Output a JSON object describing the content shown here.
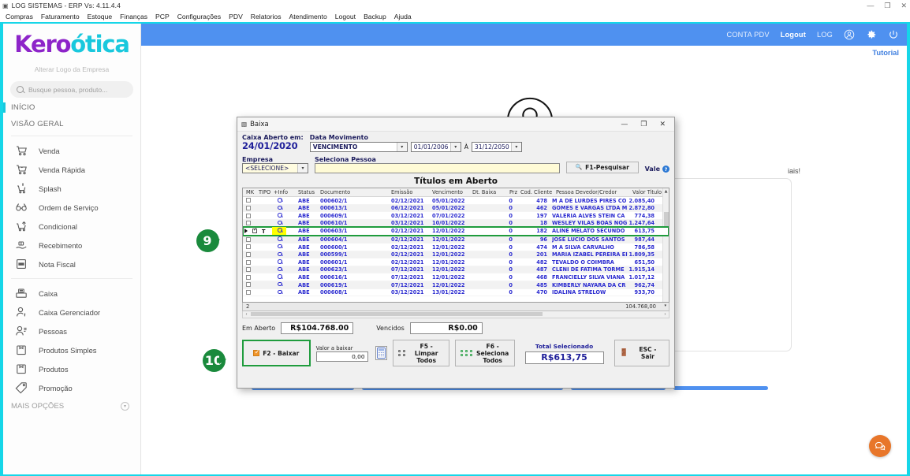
{
  "window": {
    "title": "LOG SISTEMAS - ERP Vs: 4.11.4.4",
    "icon": "app-icon",
    "minimize": "—",
    "maximize": "❐",
    "close": "✕"
  },
  "menubar": [
    {
      "label": "Compras"
    },
    {
      "label": "Faturamento"
    },
    {
      "label": "Estoque"
    },
    {
      "label": "Finanças"
    },
    {
      "label": "PCP"
    },
    {
      "label": "Configurações"
    },
    {
      "label": "PDV"
    },
    {
      "label": "Relatorios"
    },
    {
      "label": "Atendimento"
    },
    {
      "label": "Logout"
    },
    {
      "label": "Backup"
    },
    {
      "label": "Ajuda"
    }
  ],
  "sidebar": {
    "logo_part1": "Kero",
    "logo_part2": "ótica",
    "logo_sub": "Alterar Logo da Empresa",
    "search_placeholder": "Busque pessoa, produto...",
    "section_inicio": "INÍCIO",
    "section_visao": "VISÃO GERAL",
    "items": [
      {
        "label": "Venda",
        "icon": "cart-icon"
      },
      {
        "label": "Venda Rápida",
        "icon": "cart-fast-icon"
      },
      {
        "label": "Splash",
        "icon": "cart-dollar-icon"
      },
      {
        "label": "Ordem de Serviço",
        "icon": "glasses-icon"
      },
      {
        "label": "Condicional",
        "icon": "cart-arrow-icon"
      },
      {
        "label": "Recebimento",
        "icon": "hand-money-icon"
      },
      {
        "label": "Nota Fiscal",
        "icon": "nfe-icon"
      }
    ],
    "items2": [
      {
        "label": "Caixa",
        "icon": "cash-register-icon"
      },
      {
        "label": "Caixa Gerenciador",
        "icon": "user-dollar-icon"
      },
      {
        "label": "Pessoas",
        "icon": "user-list-icon"
      },
      {
        "label": "Produtos Simples",
        "icon": "box-simple-icon"
      },
      {
        "label": "Produtos",
        "icon": "box-icon"
      },
      {
        "label": "Promoção",
        "icon": "tag-icon"
      }
    ],
    "more_label": "MAIS OPÇÕES",
    "more_icon": "chevron-down-circle-icon"
  },
  "header": {
    "conta_pdv": "CONTA PDV",
    "logout": "Logout",
    "log": "LOG",
    "user_icon": "user-circle-icon",
    "gear_icon": "gear-icon",
    "power_icon": "power-icon",
    "tutorial": "Tutorial",
    "accent": "#4f91f0"
  },
  "background": {
    "avatar_icon": "user-avatar-icon",
    "hint_text": "iais!",
    "chat_icon": "chat-bubble-icon",
    "chat_color": "#e8762a"
  },
  "dialog": {
    "title": "Baixa",
    "title_icon": "window-icon",
    "minimize": "—",
    "maximize": "❐",
    "close": "✕",
    "caixa_aberto_label": "Caixa Aberto em:",
    "caixa_aberto_value": "24/01/2020",
    "data_movimento_label": "Data Movimento",
    "data_movimento_value": "VENCIMENTO",
    "date_from": "01/01/2006",
    "date_sep": "À",
    "date_to": "31/12/2050",
    "empresa_label": "Empresa",
    "empresa_value": "<SELECIONE>",
    "pessoa_label": "Seleciona Pessoa",
    "pessoa_value": "",
    "pesquisar_button": "F1-Pesquisar",
    "pesquisar_icon": "search-icon",
    "vale_label": "Vale",
    "vale_icon": "help-icon",
    "grid_title": "Títulos em Aberto",
    "columns": [
      "MK",
      "TIPO",
      "+Info",
      "Status",
      "Documento",
      "Emissão",
      "Vencimento",
      "Dt. Baixa",
      "Prz",
      "Cod. Cliente",
      "Pessoa Devedor/Credor",
      "Valor Titulo"
    ],
    "rows": [
      {
        "tipo": "",
        "status": "ABE",
        "documento": "000602/1",
        "emissao": "02/12/2021",
        "vencimento": "05/01/2022",
        "dt_baixa": "",
        "prz": "0",
        "cod": "478",
        "pessoa": "M A DE LURDES PIRES CO",
        "valor": "2.085,40",
        "selected": false
      },
      {
        "tipo": "",
        "status": "ABE",
        "documento": "000613/1",
        "emissao": "06/12/2021",
        "vencimento": "05/01/2022",
        "dt_baixa": "",
        "prz": "0",
        "cod": "462",
        "pessoa": "GOMES E VARGAS LTDA M",
        "valor": "2.872,80",
        "selected": false
      },
      {
        "tipo": "",
        "status": "ABE",
        "documento": "000609/1",
        "emissao": "03/12/2021",
        "vencimento": "07/01/2022",
        "dt_baixa": "",
        "prz": "0",
        "cod": "197",
        "pessoa": "VALERIA ALVES STEIN CA",
        "valor": "774,38",
        "selected": false
      },
      {
        "tipo": "",
        "status": "ABE",
        "documento": "000610/1",
        "emissao": "03/12/2021",
        "vencimento": "10/01/2022",
        "dt_baixa": "",
        "prz": "0",
        "cod": "18",
        "pessoa": "WESLEY VILAS BOAS NOG",
        "valor": "1.247,64",
        "selected": false
      },
      {
        "tipo": "T",
        "status": "ABE",
        "documento": "000603/1",
        "emissao": "02/12/2021",
        "vencimento": "12/01/2022",
        "dt_baixa": "",
        "prz": "0",
        "cod": "182",
        "pessoa": "ALINE MELATO SECUNDO",
        "valor": "613,75",
        "selected": true
      },
      {
        "tipo": "",
        "status": "ABE",
        "documento": "000604/1",
        "emissao": "02/12/2021",
        "vencimento": "12/01/2022",
        "dt_baixa": "",
        "prz": "0",
        "cod": "96",
        "pessoa": "JOSE LUCIO DOS SANTOS",
        "valor": "987,44",
        "selected": false
      },
      {
        "tipo": "",
        "status": "ABE",
        "documento": "000600/1",
        "emissao": "02/12/2021",
        "vencimento": "12/01/2022",
        "dt_baixa": "",
        "prz": "0",
        "cod": "474",
        "pessoa": "M A SILVA CARVALHO",
        "valor": "786,58",
        "selected": false
      },
      {
        "tipo": "",
        "status": "ABE",
        "documento": "000599/1",
        "emissao": "02/12/2021",
        "vencimento": "12/01/2022",
        "dt_baixa": "",
        "prz": "0",
        "cod": "201",
        "pessoa": "MARIA IZABEL PEREIRA EI",
        "valor": "1.809,35",
        "selected": false
      },
      {
        "tipo": "",
        "status": "ABE",
        "documento": "000601/1",
        "emissao": "02/12/2021",
        "vencimento": "12/01/2022",
        "dt_baixa": "",
        "prz": "0",
        "cod": "482",
        "pessoa": "TEVALDO O COIMBRA",
        "valor": "651,50",
        "selected": false
      },
      {
        "tipo": "",
        "status": "ABE",
        "documento": "000623/1",
        "emissao": "07/12/2021",
        "vencimento": "12/01/2022",
        "dt_baixa": "",
        "prz": "0",
        "cod": "487",
        "pessoa": "CLENI DE FATIMA TORME",
        "valor": "1.915,14",
        "selected": false
      },
      {
        "tipo": "",
        "status": "ABE",
        "documento": "000616/1",
        "emissao": "07/12/2021",
        "vencimento": "12/01/2022",
        "dt_baixa": "",
        "prz": "0",
        "cod": "468",
        "pessoa": "FRANCIELLY SILVA VIANA",
        "valor": "1.017,12",
        "selected": false
      },
      {
        "tipo": "",
        "status": "ABE",
        "documento": "000619/1",
        "emissao": "07/12/2021",
        "vencimento": "12/01/2022",
        "dt_baixa": "",
        "prz": "0",
        "cod": "485",
        "pessoa": "KIMBERLY  NAYARA DA CR",
        "valor": "962,74",
        "selected": false
      },
      {
        "tipo": "",
        "status": "ABE",
        "documento": "000608/1",
        "emissao": "03/12/2021",
        "vencimento": "13/01/2022",
        "dt_baixa": "",
        "prz": "0",
        "cod": "470",
        "pessoa": "IDALINA STRELOW",
        "valor": "933,70",
        "selected": false
      }
    ],
    "footer_count": "2",
    "footer_total": "104.768,00",
    "em_aberto_label": "Em Aberto",
    "em_aberto_value": "R$104.768.00",
    "vencidos_label": "Vencidos",
    "vencidos_value": "R$0.00",
    "btn_baixar": "F2 - Baixar",
    "valor_baixar_label": "Valor a baixar",
    "valor_baixar_value": "0,00",
    "calc_icon": "calculator-icon",
    "btn_limpar_l1": "F5 -Limpar",
    "btn_limpar_l2": "Todos",
    "btn_seleciona_l1": "F6 - Seleciona",
    "btn_seleciona_l2": "Todos",
    "total_selecionado_label": "Total Selecionado",
    "total_selecionado_value": "R$613,75",
    "btn_sair": "ESC - Sair",
    "sair_icon": "exit-icon"
  },
  "markers": [
    {
      "number": "9"
    },
    {
      "number": "10"
    }
  ]
}
